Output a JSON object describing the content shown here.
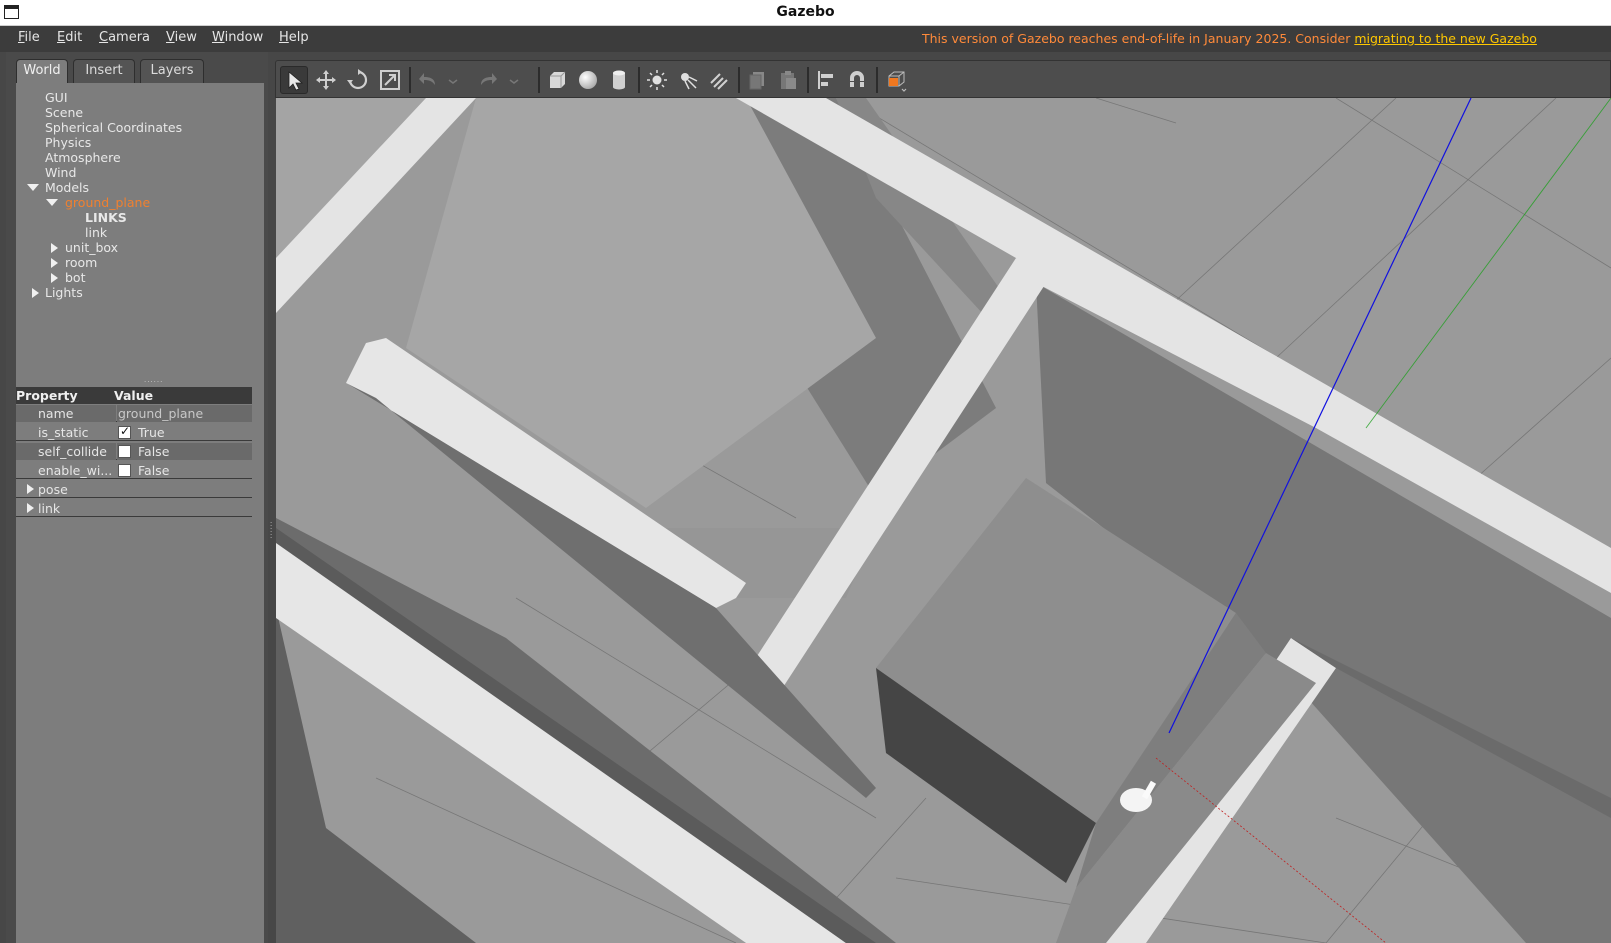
{
  "window": {
    "title": "Gazebo"
  },
  "menu": [
    {
      "label": "File",
      "key": "F",
      "rest": "ile"
    },
    {
      "label": "Edit",
      "key": "E",
      "rest": "dit"
    },
    {
      "label": "Camera",
      "key": "C",
      "rest": "amera"
    },
    {
      "label": "View",
      "key": "V",
      "rest": "iew"
    },
    {
      "label": "Window",
      "key": "W",
      "rest": "indow"
    },
    {
      "label": "Help",
      "key": "H",
      "rest": "elp"
    }
  ],
  "notice": {
    "text": "This version of Gazebo reaches end-of-life in January 2025. Consider ",
    "link": "migrating to the new Gazebo",
    "color": "#ff8a3a",
    "link_color": "#ffc800"
  },
  "tabs": [
    "World",
    "Insert",
    "Layers"
  ],
  "tree": {
    "items": [
      "GUI",
      "Scene",
      "Spherical Coordinates",
      "Physics",
      "Atmosphere",
      "Wind"
    ],
    "models_label": "Models",
    "selected_model": "ground_plane",
    "links_header": "LINKS",
    "link": "link",
    "other_models": [
      "unit_box",
      "room",
      "bot"
    ],
    "lights_label": "Lights"
  },
  "properties": {
    "header": {
      "property": "Property",
      "value": "Value"
    },
    "rows": [
      {
        "name": "name",
        "value": "ground_plane",
        "type": "text"
      },
      {
        "name": "is_static",
        "value": "True",
        "type": "check",
        "checked": true
      },
      {
        "name": "self_collide",
        "value": "False",
        "type": "check",
        "checked": false
      },
      {
        "name": "enable_wi...",
        "value": "False",
        "type": "check",
        "checked": false
      }
    ],
    "groups": [
      "pose",
      "link"
    ]
  },
  "toolbar": {
    "tools": [
      "select-mode",
      "translate-mode",
      "rotate-mode",
      "scale-mode",
      "undo",
      "redo",
      "box-shape",
      "sphere-shape",
      "cylinder-shape",
      "point-light",
      "spot-light",
      "directional-light",
      "copy",
      "paste",
      "align",
      "snap",
      "view-angle"
    ]
  }
}
